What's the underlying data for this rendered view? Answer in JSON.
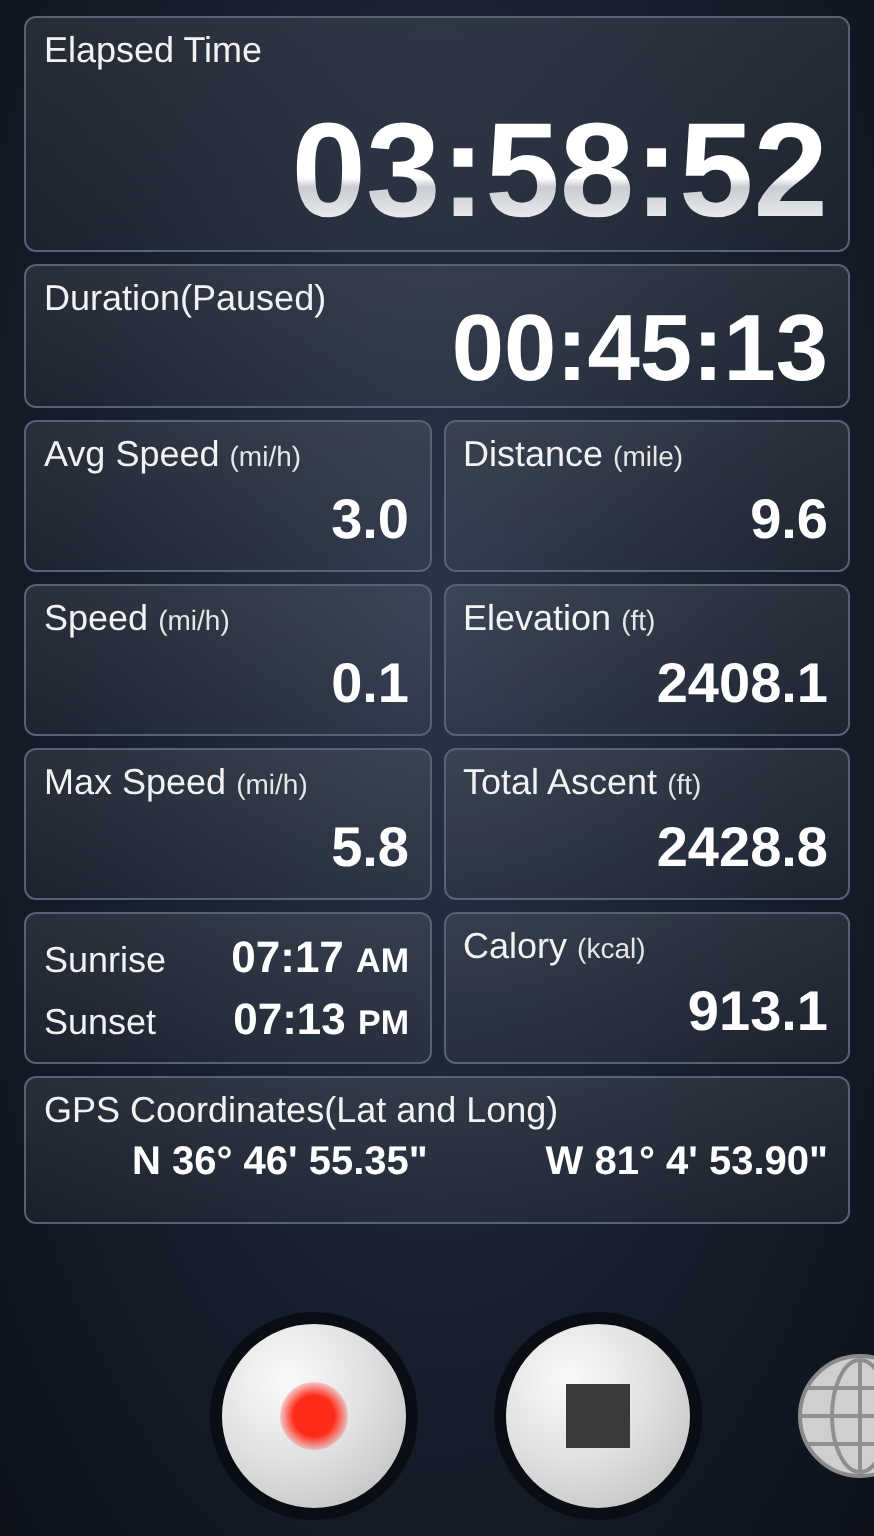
{
  "elapsed": {
    "label": "Elapsed Time",
    "value": "03:58:52"
  },
  "duration": {
    "label": "Duration(Paused)",
    "value": "00:45:13"
  },
  "cells": [
    {
      "kind": "stat",
      "label": "Avg Speed",
      "unit": "(mi/h)",
      "value": "3.0"
    },
    {
      "kind": "stat",
      "label": "Distance",
      "unit": "(mile)",
      "value": "9.6"
    },
    {
      "kind": "stat",
      "label": "Speed",
      "unit": "(mi/h)",
      "value": "0.1"
    },
    {
      "kind": "stat",
      "label": "Elevation",
      "unit": "(ft)",
      "value": "2408.1"
    },
    {
      "kind": "stat",
      "label": "Max Speed",
      "unit": "(mi/h)",
      "value": "5.8"
    },
    {
      "kind": "stat",
      "label": "Total Ascent",
      "unit": "(ft)",
      "value": "2428.8"
    },
    {
      "kind": "sun",
      "rows": [
        {
          "label": "Sunrise",
          "time": "07:17",
          "period": "AM"
        },
        {
          "label": "Sunset",
          "time": "07:13",
          "period": "PM"
        }
      ]
    },
    {
      "kind": "stat",
      "label": "Calory",
      "unit": "(kcal)",
      "value": "913.1"
    }
  ],
  "gps": {
    "label": "GPS Coordinates(Lat and Long)",
    "lat": "N 36° 46' 55.35\"",
    "long": "W 81° 4' 53.90\""
  },
  "controls": [
    {
      "kind": "record"
    },
    {
      "kind": "stop"
    },
    {
      "kind": "globe"
    }
  ]
}
